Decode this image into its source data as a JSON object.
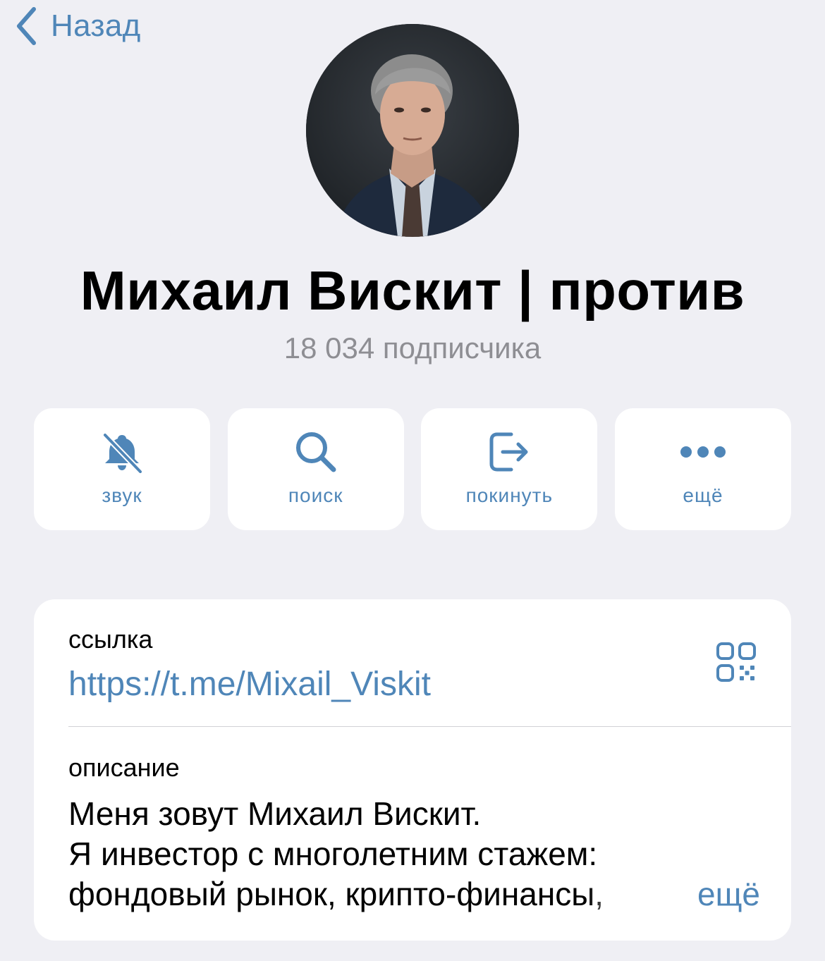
{
  "nav": {
    "back_label": "Назад"
  },
  "channel": {
    "title": "Михаил Вискит | против",
    "subscribers": "18 034 подписчика"
  },
  "actions": [
    {
      "label": "звук",
      "icon": "bell-slash-icon"
    },
    {
      "label": "поиск",
      "icon": "search-icon"
    },
    {
      "label": "покинуть",
      "icon": "leave-icon"
    },
    {
      "label": "ещё",
      "icon": "more-dots-icon"
    }
  ],
  "info": {
    "link_caption": "ссылка",
    "link_value": "https://t.me/Mixail_Viskit",
    "description_caption": "описание",
    "description_lines": [
      "Меня зовут Михаил Вискит.",
      "Я инвестор с многолетним стажем:",
      "фондовый рынок, крипто-финансы,"
    ],
    "more_label": "ещё"
  },
  "colors": {
    "background": "#efeff4",
    "accent": "#4f86b8",
    "secondary_text": "#8e8e93",
    "card": "#ffffff"
  }
}
